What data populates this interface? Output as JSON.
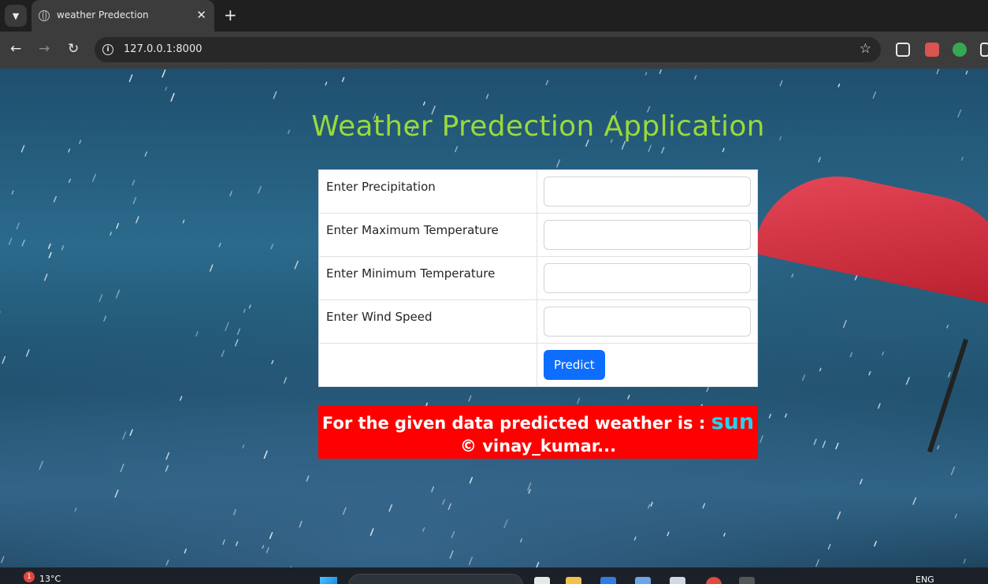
{
  "browser": {
    "tab_title": "weather Predection",
    "url": "127.0.0.1:8000"
  },
  "page": {
    "title": "Weather Predection Application",
    "fields": [
      {
        "label": "Enter Precipitation",
        "value": ""
      },
      {
        "label": "Enter Maximum Temperature",
        "value": ""
      },
      {
        "label": "Enter Minimum Temperature",
        "value": ""
      },
      {
        "label": "Enter Wind Speed",
        "value": ""
      }
    ],
    "predict_label": "Predict",
    "result_prefix": "For the given data predicted weather is : ",
    "result_value": "sun",
    "footer": "© vinay_kumar..."
  },
  "taskbar": {
    "weather_badge": "1",
    "temperature": "13°C",
    "language": "ENG"
  },
  "colors": {
    "title": "#9ad93a",
    "result_bg": "#ff0000",
    "result_value": "#22d3ee",
    "button": "#0d6efd"
  }
}
